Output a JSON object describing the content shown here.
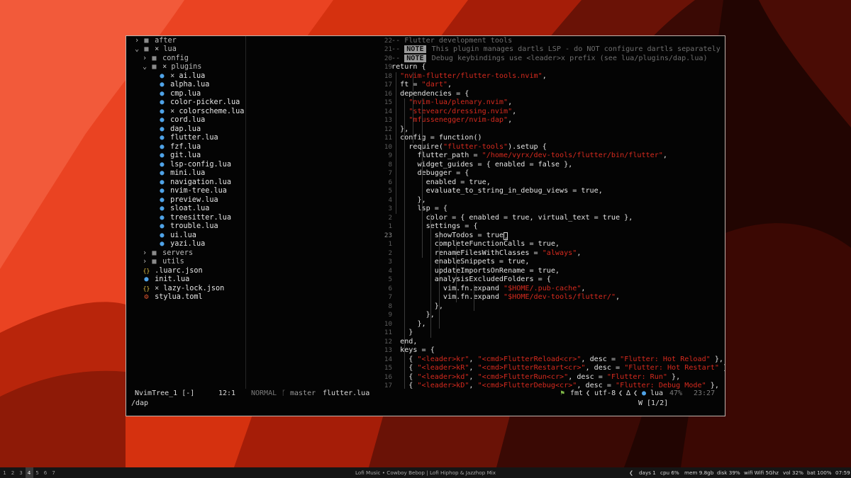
{
  "tree": [
    {
      "depth": 1,
      "kind": "folder",
      "open": false,
      "name": "after"
    },
    {
      "depth": 1,
      "kind": "folder-lua",
      "open": true,
      "name": "lua",
      "mark": "×"
    },
    {
      "depth": 2,
      "kind": "folder",
      "open": false,
      "name": "config"
    },
    {
      "depth": 2,
      "kind": "folder-lua",
      "open": true,
      "name": "plugins",
      "mark": "×"
    },
    {
      "depth": 3,
      "kind": "lua",
      "name": "ai.lua",
      "mark": "×"
    },
    {
      "depth": 3,
      "kind": "lua",
      "name": "alpha.lua"
    },
    {
      "depth": 3,
      "kind": "lua",
      "name": "cmp.lua"
    },
    {
      "depth": 3,
      "kind": "lua",
      "name": "color-picker.lua"
    },
    {
      "depth": 3,
      "kind": "lua",
      "name": "colorscheme.lua",
      "mark": "×"
    },
    {
      "depth": 3,
      "kind": "lua",
      "name": "cord.lua"
    },
    {
      "depth": 3,
      "kind": "lua",
      "name": "dap.lua"
    },
    {
      "depth": 3,
      "kind": "lua",
      "name": "flutter.lua"
    },
    {
      "depth": 3,
      "kind": "lua",
      "name": "fzf.lua"
    },
    {
      "depth": 3,
      "kind": "lua",
      "name": "git.lua"
    },
    {
      "depth": 3,
      "kind": "lua",
      "name": "lsp-config.lua"
    },
    {
      "depth": 3,
      "kind": "lua",
      "name": "mini.lua"
    },
    {
      "depth": 3,
      "kind": "lua",
      "name": "navigation.lua"
    },
    {
      "depth": 3,
      "kind": "lua",
      "name": "nvim-tree.lua"
    },
    {
      "depth": 3,
      "kind": "lua",
      "name": "preview.lua"
    },
    {
      "depth": 3,
      "kind": "lua",
      "name": "sloat.lua"
    },
    {
      "depth": 3,
      "kind": "lua",
      "name": "treesitter.lua"
    },
    {
      "depth": 3,
      "kind": "lua",
      "name": "trouble.lua"
    },
    {
      "depth": 3,
      "kind": "lua",
      "name": "ui.lua"
    },
    {
      "depth": 3,
      "kind": "lua",
      "name": "yazi.lua"
    },
    {
      "depth": 2,
      "kind": "folder",
      "open": false,
      "name": "servers"
    },
    {
      "depth": 2,
      "kind": "folder",
      "open": false,
      "name": "utils"
    },
    {
      "depth": 1,
      "kind": "json",
      "name": ".luarc.json"
    },
    {
      "depth": 1,
      "kind": "lua",
      "name": "init.lua"
    },
    {
      "depth": 1,
      "kind": "json",
      "name": "lazy-lock.json",
      "mark": "×"
    },
    {
      "depth": 1,
      "kind": "toml",
      "name": "stylua.toml"
    }
  ],
  "code": [
    {
      "n": "22",
      "segs": [
        [
          "cm",
          "-- Flutter development tools"
        ]
      ]
    },
    {
      "n": "21",
      "segs": [
        [
          "cm",
          "-- "
        ],
        [
          "note",
          "NOTE"
        ],
        [
          "cm",
          " This plugin manages dartls LSP - do NOT configure dartls separately"
        ]
      ]
    },
    {
      "n": "20",
      "segs": [
        [
          "cm",
          "-- "
        ],
        [
          "note",
          "NOTE"
        ],
        [
          "cm",
          " Debug keybindings use <leader>x prefix (see lua/plugins/dap.lua)"
        ]
      ]
    },
    {
      "n": "19",
      "segs": [
        [
          "t",
          "return {"
        ]
      ]
    },
    {
      "n": "18",
      "segs": [
        [
          "t",
          "  "
        ],
        [
          "str",
          "\"nvim-flutter/flutter-tools.nvim\""
        ],
        [
          "t",
          ","
        ]
      ]
    },
    {
      "n": "17",
      "segs": [
        [
          "t",
          "  ft = "
        ],
        [
          "str",
          "\"dart\""
        ],
        [
          "t",
          ","
        ]
      ]
    },
    {
      "n": "16",
      "segs": [
        [
          "t",
          "  dependencies = {"
        ]
      ]
    },
    {
      "n": "15",
      "segs": [
        [
          "t",
          "    "
        ],
        [
          "str",
          "\"nvim-lua/plenary.nvim\""
        ],
        [
          "t",
          ","
        ]
      ]
    },
    {
      "n": "14",
      "segs": [
        [
          "t",
          "    "
        ],
        [
          "str",
          "\"stevearc/dressing.nvim\""
        ],
        [
          "t",
          ","
        ]
      ]
    },
    {
      "n": "13",
      "segs": [
        [
          "t",
          "    "
        ],
        [
          "str",
          "\"mfussenegger/nvim-dap\""
        ],
        [
          "t",
          ","
        ]
      ]
    },
    {
      "n": "12",
      "segs": [
        [
          "t",
          "  },"
        ]
      ]
    },
    {
      "n": "11",
      "segs": [
        [
          "t",
          "  config = function()"
        ]
      ]
    },
    {
      "n": "10",
      "segs": [
        [
          "t",
          "    require("
        ],
        [
          "str",
          "\"flutter-tools\""
        ],
        [
          "t",
          ").setup {"
        ]
      ]
    },
    {
      "n": "9",
      "segs": [
        [
          "t",
          "      flutter_path = "
        ],
        [
          "str",
          "\"/home/vyrx/dev-tools/flutter/bin/flutter\""
        ],
        [
          "t",
          ","
        ]
      ]
    },
    {
      "n": "8",
      "segs": [
        [
          "t",
          "      widget_guides = { enabled = false },"
        ]
      ]
    },
    {
      "n": "7",
      "segs": [
        [
          "t",
          "      debugger = {"
        ]
      ]
    },
    {
      "n": "6",
      "segs": [
        [
          "t",
          "        enabled = true,"
        ]
      ]
    },
    {
      "n": "5",
      "segs": [
        [
          "t",
          "        evaluate_to_string_in_debug_views = true,"
        ]
      ]
    },
    {
      "n": "4",
      "segs": [
        [
          "t",
          "      },"
        ]
      ]
    },
    {
      "n": "3",
      "segs": [
        [
          "t",
          "      lsp = {"
        ]
      ]
    },
    {
      "n": "2",
      "segs": [
        [
          "t",
          "        color = { enabled = true, virtual_text = true },"
        ]
      ]
    },
    {
      "n": "1",
      "segs": [
        [
          "t",
          "        settings = {"
        ]
      ]
    },
    {
      "n": "23",
      "cur": true,
      "segs": [
        [
          "t",
          "          showTodos = true"
        ],
        [
          "cursor",
          ","
        ]
      ]
    },
    {
      "n": "1",
      "segs": [
        [
          "t",
          "          completeFunctionCalls = true,"
        ]
      ]
    },
    {
      "n": "2",
      "segs": [
        [
          "t",
          "          renameFilesWithClasses = "
        ],
        [
          "str",
          "\"always\""
        ],
        [
          "t",
          ","
        ]
      ]
    },
    {
      "n": "3",
      "segs": [
        [
          "t",
          "          enableSnippets = true,"
        ]
      ]
    },
    {
      "n": "4",
      "segs": [
        [
          "t",
          "          updateImportsOnRename = true,"
        ]
      ]
    },
    {
      "n": "5",
      "segs": [
        [
          "t",
          "          analysisExcludedFolders = {"
        ]
      ]
    },
    {
      "n": "6",
      "segs": [
        [
          "t",
          "            vim.fn.expand "
        ],
        [
          "str",
          "\"$HOME/.pub-cache\""
        ],
        [
          "t",
          ","
        ]
      ]
    },
    {
      "n": "7",
      "segs": [
        [
          "t",
          "            vim.fn.expand "
        ],
        [
          "str",
          "\"$HOME/dev-tools/flutter/\""
        ],
        [
          "t",
          ","
        ]
      ]
    },
    {
      "n": "8",
      "segs": [
        [
          "t",
          "          },"
        ]
      ]
    },
    {
      "n": "9",
      "segs": [
        [
          "t",
          "        },"
        ]
      ]
    },
    {
      "n": "10",
      "segs": [
        [
          "t",
          "      },"
        ]
      ]
    },
    {
      "n": "11",
      "segs": [
        [
          "t",
          "    }"
        ]
      ]
    },
    {
      "n": "12",
      "segs": [
        [
          "t",
          "  end,"
        ]
      ]
    },
    {
      "n": "13",
      "segs": [
        [
          "t",
          "  keys = {"
        ]
      ]
    },
    {
      "n": "14",
      "segs": [
        [
          "t",
          "    { "
        ],
        [
          "str",
          "\"<leader>kr\""
        ],
        [
          "t",
          ", "
        ],
        [
          "str",
          "\"<cmd>FlutterReload<cr>\""
        ],
        [
          "t",
          ", desc = "
        ],
        [
          "str",
          "\"Flutter: Hot Reload\""
        ],
        [
          "t",
          " },"
        ]
      ]
    },
    {
      "n": "15",
      "segs": [
        [
          "t",
          "    { "
        ],
        [
          "str",
          "\"<leader>kR\""
        ],
        [
          "t",
          ", "
        ],
        [
          "str",
          "\"<cmd>FlutterRestart<cr>\""
        ],
        [
          "t",
          ", desc = "
        ],
        [
          "str",
          "\"Flutter: Hot Restart\""
        ],
        [
          "t",
          " },"
        ]
      ]
    },
    {
      "n": "16",
      "segs": [
        [
          "t",
          "    { "
        ],
        [
          "str",
          "\"<leader>kd\""
        ],
        [
          "t",
          ", "
        ],
        [
          "str",
          "\"<cmd>FlutterRun<cr>\""
        ],
        [
          "t",
          ", desc = "
        ],
        [
          "str",
          "\"Flutter: Run\""
        ],
        [
          "t",
          " },"
        ]
      ]
    },
    {
      "n": "17",
      "segs": [
        [
          "t",
          "    { "
        ],
        [
          "str",
          "\"<leader>kD\""
        ],
        [
          "t",
          ", "
        ],
        [
          "str",
          "\"<cmd>FlutterDebug<cr>\""
        ],
        [
          "t",
          ", desc = "
        ],
        [
          "str",
          "\"Flutter: Debug Mode\""
        ],
        [
          "t",
          " },"
        ]
      ]
    }
  ],
  "status": {
    "tree_name": "NvimTree_1 [-]",
    "tree_pos": "12:1",
    "mode": "NORMAL",
    "branch": "master",
    "file": "flutter.lua",
    "fmt": "fmt",
    "encoding": "utf-8",
    "filetype": "lua",
    "percent": "47%",
    "position": "23:27"
  },
  "cmdline": {
    "text": "/dap",
    "search_count": "W [1/2]"
  },
  "taskbar": {
    "workspaces": [
      "1",
      "2",
      "3",
      "4",
      "5",
      "6",
      "7"
    ],
    "active_workspace": "4",
    "media": "Lofi Music • Cowboy Bebop | Lofi Hiphop & Jazzhop Mix",
    "days": "days 1",
    "cpu": "cpu 6%",
    "mem": "mem 9.8gb",
    "disk": "disk 39%",
    "wifi": "wifi Wifi 5Ghz",
    "vol": "vol 32%",
    "bat": "bat 100%",
    "clock": "07:59"
  },
  "colors": {
    "accent_red": "#d62a1e",
    "wallpaper_light": "#f04a2a",
    "wallpaper_dark": "#2a0603",
    "lua_icon": "#4fa3e8",
    "json_icon": "#e8c547",
    "toml_icon": "#e0542e",
    "fmt_icon": "#7fb847"
  }
}
